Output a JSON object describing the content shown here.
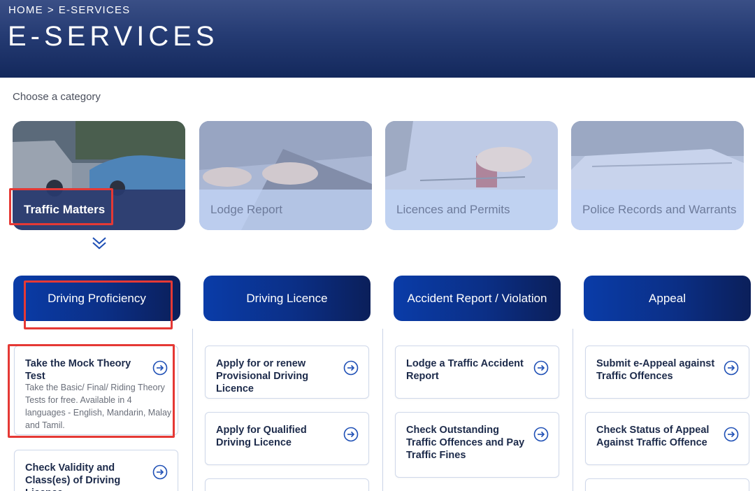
{
  "header": {
    "breadcrumb_home": "HOME",
    "breadcrumb_sep": ">",
    "breadcrumb_current": "E-SERVICES",
    "title": "E-SERVICES"
  },
  "choose_label": "Choose a category",
  "categories": [
    {
      "label": "Traffic Matters",
      "active": true
    },
    {
      "label": "Lodge Report",
      "active": false
    },
    {
      "label": "Licences and Permits",
      "active": false
    },
    {
      "label": "Police Records and Warrants",
      "active": false
    }
  ],
  "subtabs": [
    {
      "label": "Driving Proficiency"
    },
    {
      "label": "Driving Licence"
    },
    {
      "label": "Accident Report / Violation"
    },
    {
      "label": "Appeal"
    }
  ],
  "columns": [
    {
      "cards": [
        {
          "title": "Take the Mock Theory Test",
          "desc": "Take the Basic/ Final/ Riding Theory Tests for free. Available in 4 languages - English, Mandarin, Malay and Tamil."
        },
        {
          "title": "Check Validity and Class(es) of Driving Licence"
        }
      ]
    },
    {
      "cards": [
        {
          "title": "Apply for or renew Provisional Driving Licence"
        },
        {
          "title": "Apply for Qualified Driving Licence"
        }
      ]
    },
    {
      "cards": [
        {
          "title": "Lodge a Traffic Accident Report"
        },
        {
          "title": "Check Outstanding Traffic Offences and Pay Traffic Fines"
        }
      ]
    },
    {
      "cards": [
        {
          "title": "Submit e-Appeal against Traffic Offences"
        },
        {
          "title": "Check Status of Appeal Against Traffic Offence"
        }
      ]
    }
  ],
  "colors": {
    "header_dark": "#13285c",
    "tab_blue": "#0a3ca8",
    "highlight_red": "#e53935",
    "icon_blue": "#1e4fb5"
  },
  "icons": {
    "go": "arrow-circle-right-icon",
    "expand": "double-chevron-down-icon"
  }
}
